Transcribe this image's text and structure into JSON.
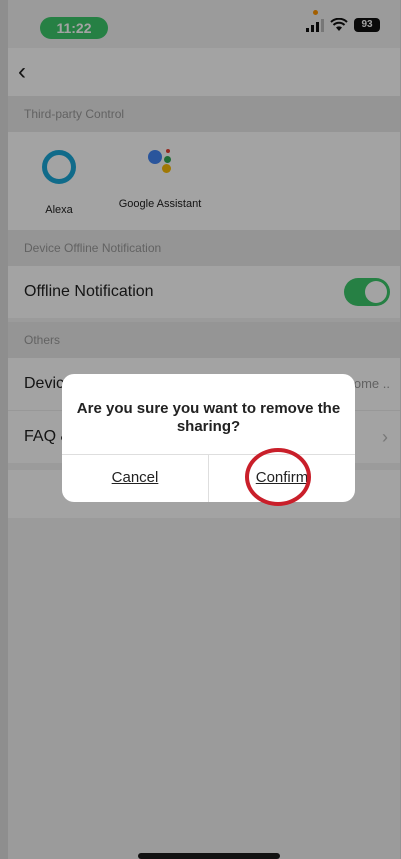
{
  "status": {
    "time": "11:22",
    "battery": "93"
  },
  "sections": {
    "third_party": "Third-party Control",
    "offline": "Device Offline Notification",
    "others": "Others"
  },
  "third_party": {
    "alexa": "Alexa",
    "google": "Google Assistant"
  },
  "rows": {
    "offline_notification": "Offline Notification",
    "device_partial": "Devic",
    "device_value_partial": "Home ..",
    "faq_partial": "FAQ &"
  },
  "dialog": {
    "message": "Are you sure you want to remove the sharing?",
    "cancel": "Cancel",
    "confirm": "Confirm"
  },
  "colors": {
    "accent_green": "#3cc96b",
    "highlight_red": "#c91f2a"
  }
}
